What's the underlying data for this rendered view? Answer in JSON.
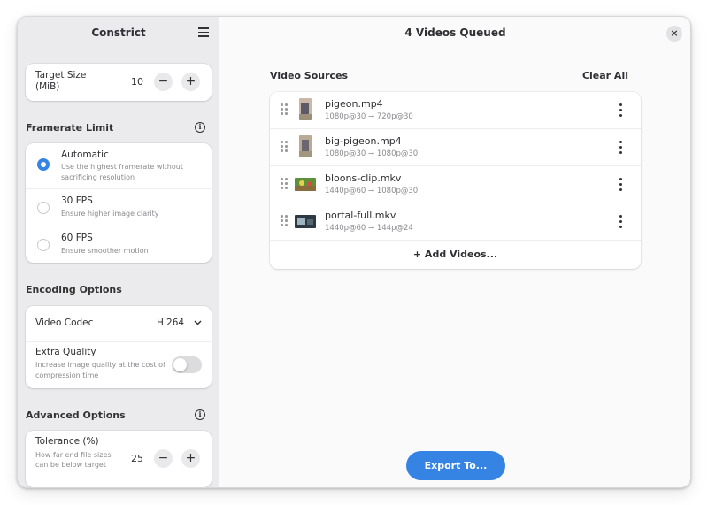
{
  "sidebar": {
    "title": "Constrict",
    "target_size": {
      "label": "Target Size (MiB)",
      "value": "10",
      "minus": "−",
      "plus": "+"
    },
    "framerate": {
      "heading": "Framerate Limit",
      "info": "i",
      "options": [
        {
          "title": "Automatic",
          "subtitle": "Use the highest framerate without sacrificing resolution",
          "selected": true
        },
        {
          "title": "30 FPS",
          "subtitle": "Ensure higher image clarity",
          "selected": false
        },
        {
          "title": "60 FPS",
          "subtitle": "Ensure smoother motion",
          "selected": false
        }
      ]
    },
    "encoding": {
      "heading": "Encoding Options",
      "codec_label": "Video Codec",
      "codec_value": "H.264",
      "extra_quality_label": "Extra Quality",
      "extra_quality_sub": "Increase image quality at the cost of compression time",
      "extra_quality_on": false
    },
    "advanced": {
      "heading": "Advanced Options",
      "info": "i",
      "tolerance_label": "Tolerance (%)",
      "tolerance_sub": "How far end file sizes can be below target",
      "tolerance_value": "25",
      "minus": "−",
      "plus": "+"
    }
  },
  "main": {
    "title": "4 Videos Queued",
    "close": "×",
    "sources_heading": "Video Sources",
    "clear_all": "Clear All",
    "videos": [
      {
        "name": "pigeon.mp4",
        "resolution": "1080p@30 → 720p@30"
      },
      {
        "name": "big-pigeon.mp4",
        "resolution": "1080p@30 → 1080p@30"
      },
      {
        "name": "bloons-clip.mkv",
        "resolution": "1440p@60 → 1080p@30"
      },
      {
        "name": "portal-full.mkv",
        "resolution": "1440p@60 → 144p@24"
      }
    ],
    "add_videos": "+ Add Videos...",
    "export": "Export To..."
  },
  "colors": {
    "accent": "#3584e4",
    "sidebar_bg": "#ebebed",
    "main_bg": "#fafafa"
  },
  "icons": [
    "menu-icon",
    "close-icon",
    "info-icon",
    "chevron-down-icon",
    "drag-handle-icon",
    "more-options-icon",
    "add-icon"
  ]
}
